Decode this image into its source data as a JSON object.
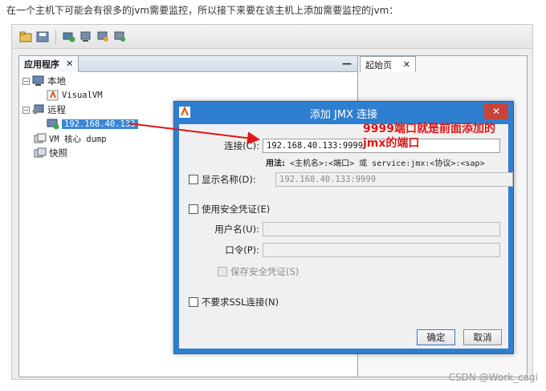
{
  "caption": "在一个主机下可能会有很多的jvm需要监控，所以接下来要在该主机上添加需要监控的jvm：",
  "left_panel": {
    "tab_label": "应用程序",
    "tab_close": "✕",
    "minimize": "—",
    "tree": {
      "local": "本地",
      "visualvm": "VisualVM",
      "remote": "远程",
      "remote_host": "192.168.40.133",
      "vm_dump": "VM 核心 dump",
      "snapshot": "快照"
    }
  },
  "right_panel": {
    "tab_label": "起始页",
    "tab_close": "✕"
  },
  "dialog": {
    "title": "添加 JMX 连接",
    "close": "✕",
    "connection_label": "连接(C):",
    "connection_value": "192.168.40.133:9999",
    "usage_label": "用法:",
    "usage_text": "<主机名>:<端口> 或 service:jmx:<协议>:<sap>",
    "display_name_label": "显示名称(D):",
    "display_name_value": "192.168.40.133:9999",
    "use_security_label": "使用安全凭证(E)",
    "username_label": "用户名(U):",
    "password_label": "口令(P):",
    "save_security_label": "保存安全凭证(S)",
    "no_ssl_label": "不要求SSL连接(N)",
    "ok_label": "确定",
    "cancel_label": "取消"
  },
  "annotation": "9999端口就是前面添加的jmx的端口",
  "watermark": "CSDN @Work_cagi",
  "colors": {
    "dialog_frame": "#2f7fd1",
    "selection": "#3a87d6",
    "annotation": "#e01515",
    "close_btn": "#c7433b"
  }
}
